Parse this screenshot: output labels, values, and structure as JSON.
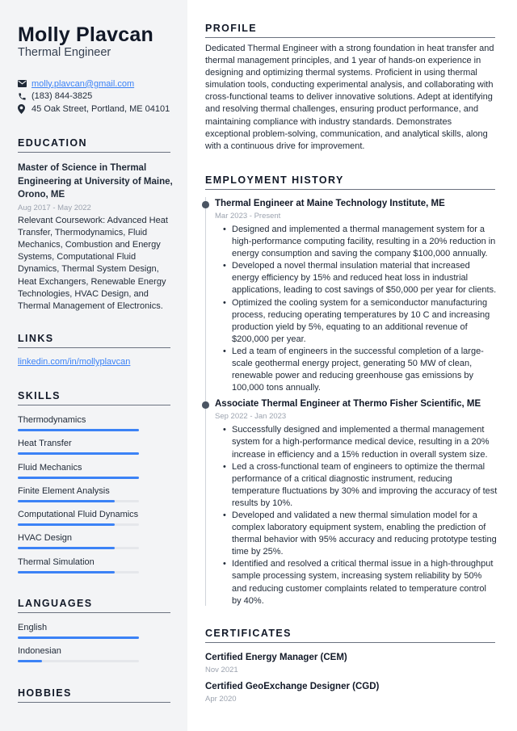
{
  "header": {
    "name": "Molly Plavcan",
    "title": "Thermal Engineer"
  },
  "contact": {
    "email": "molly.plavcan@gmail.com",
    "phone": "(183) 844-3825",
    "address": "45 Oak Street, Portland, ME 04101",
    "icons": [
      "envelope-icon",
      "phone-icon",
      "map-pin-icon"
    ]
  },
  "education": {
    "heading": "EDUCATION",
    "degree": "Master of Science in Thermal Engineering at University of Maine, Orono, ME",
    "date": "Aug 2017 - May 2022",
    "description": "Relevant Coursework: Advanced Heat Transfer, Thermodynamics, Fluid Mechanics, Combustion and Energy Systems, Computational Fluid Dynamics, Thermal System Design, Heat Exchangers, Renewable Energy Technologies, HVAC Design, and Thermal Management of Electronics."
  },
  "links": {
    "heading": "LINKS",
    "items": [
      "linkedin.com/in/mollyplavcan"
    ]
  },
  "skills": {
    "heading": "SKILLS",
    "items": [
      {
        "label": "Thermodynamics",
        "level": 1.0
      },
      {
        "label": "Heat Transfer",
        "level": 1.0
      },
      {
        "label": "Fluid Mechanics",
        "level": 1.0
      },
      {
        "label": "Finite Element Analysis",
        "level": 0.8
      },
      {
        "label": "Computational Fluid Dynamics",
        "level": 0.8
      },
      {
        "label": "HVAC Design",
        "level": 0.8
      },
      {
        "label": "Thermal Simulation",
        "level": 0.8
      }
    ]
  },
  "languages": {
    "heading": "LANGUAGES",
    "items": [
      {
        "label": "English",
        "level": 1.0
      },
      {
        "label": "Indonesian",
        "level": 0.2
      }
    ]
  },
  "hobbies": {
    "heading": "HOBBIES"
  },
  "profile": {
    "heading": "PROFILE",
    "text": "Dedicated Thermal Engineer with a strong foundation in heat transfer and thermal management principles, and 1 year of hands-on experience in designing and optimizing thermal systems. Proficient in using thermal simulation tools, conducting experimental analysis, and collaborating with cross-functional teams to deliver innovative solutions. Adept at identifying and resolving thermal challenges, ensuring product performance, and maintaining compliance with industry standards. Demonstrates exceptional problem-solving, communication, and analytical skills, along with a continuous drive for improvement."
  },
  "employment": {
    "heading": "EMPLOYMENT HISTORY",
    "jobs": [
      {
        "title": "Thermal Engineer at Maine Technology Institute, ME",
        "date": "Mar 2023 - Present",
        "bullets": [
          "Designed and implemented a thermal management system for a high-performance computing facility, resulting in a 20% reduction in energy consumption and saving the company $100,000 annually.",
          "Developed a novel thermal insulation material that increased energy efficiency by 15% and reduced heat loss in industrial applications, leading to cost savings of $50,000 per year for clients.",
          "Optimized the cooling system for a semiconductor manufacturing process, reducing operating temperatures by 10 C and increasing production yield by 5%, equating to an additional revenue of $200,000 per year.",
          "Led a team of engineers in the successful completion of a large-scale geothermal energy project, generating 50 MW of clean, renewable power and reducing greenhouse gas emissions by 100,000 tons annually."
        ]
      },
      {
        "title": "Associate Thermal Engineer at Thermo Fisher Scientific, ME",
        "date": "Sep 2022 - Jan 2023",
        "bullets": [
          "Successfully designed and implemented a thermal management system for a high-performance medical device, resulting in a 20% increase in efficiency and a 15% reduction in overall system size.",
          "Led a cross-functional team of engineers to optimize the thermal performance of a critical diagnostic instrument, reducing temperature fluctuations by 30% and improving the accuracy of test results by 10%.",
          "Developed and validated a new thermal simulation model for a complex laboratory equipment system, enabling the prediction of thermal behavior with 95% accuracy and reducing prototype testing time by 25%.",
          "Identified and resolved a critical thermal issue in a high-throughput sample processing system, increasing system reliability by 50% and reducing customer complaints related to temperature control by 40%."
        ]
      }
    ]
  },
  "certificates": {
    "heading": "CERTIFICATES",
    "items": [
      {
        "title": "Certified Energy Manager (CEM)",
        "date": "Nov 2021"
      },
      {
        "title": "Certified GeoExchange Designer (CGD)",
        "date": "Apr 2020"
      }
    ]
  },
  "colors": {
    "accent": "#3b82f6",
    "sidebar_bg": "#f3f4f6",
    "muted_text": "#9ca3af",
    "bar_track": "#e5e7eb"
  }
}
